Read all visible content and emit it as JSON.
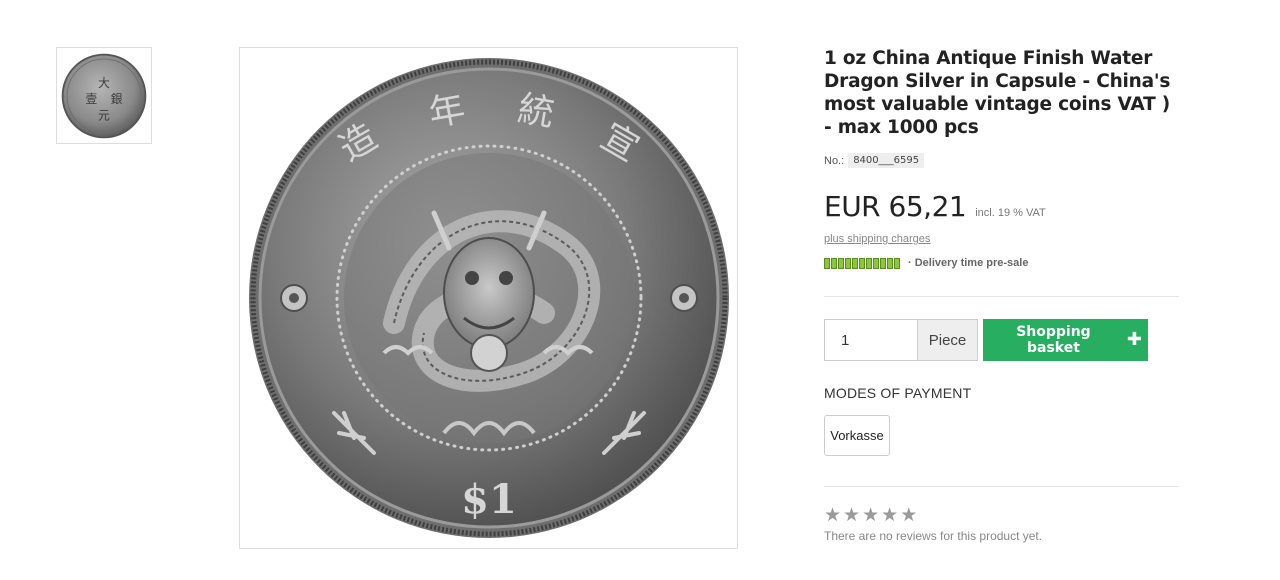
{
  "product": {
    "title": "1 oz China Antique Finish Water Dragon Silver in Capsule - China's most valuable vintage coins VAT ) - max 1000 pcs",
    "article_no_label": "No.:",
    "article_no_value": "8400___6595",
    "price": "EUR 65,21",
    "vat_note": "incl. 19 % VAT",
    "shipping_link": "plus shipping charges",
    "delivery_text": "· Delivery time pre-sale",
    "delivery_color": "#8cc63f"
  },
  "purchase": {
    "quantity": "1",
    "unit": "Piece",
    "basket_label": "Shopping basket",
    "basket_color": "#27ae60"
  },
  "payment": {
    "heading": "MODES OF PAYMENT",
    "methods": [
      "Vorkasse"
    ]
  },
  "reviews": {
    "rating": 0,
    "max": 5,
    "text": "There are no reviews for this product yet."
  },
  "coin": {
    "top_chars": [
      "宣",
      "統",
      "年",
      "造"
    ],
    "value_mark": "$1"
  }
}
